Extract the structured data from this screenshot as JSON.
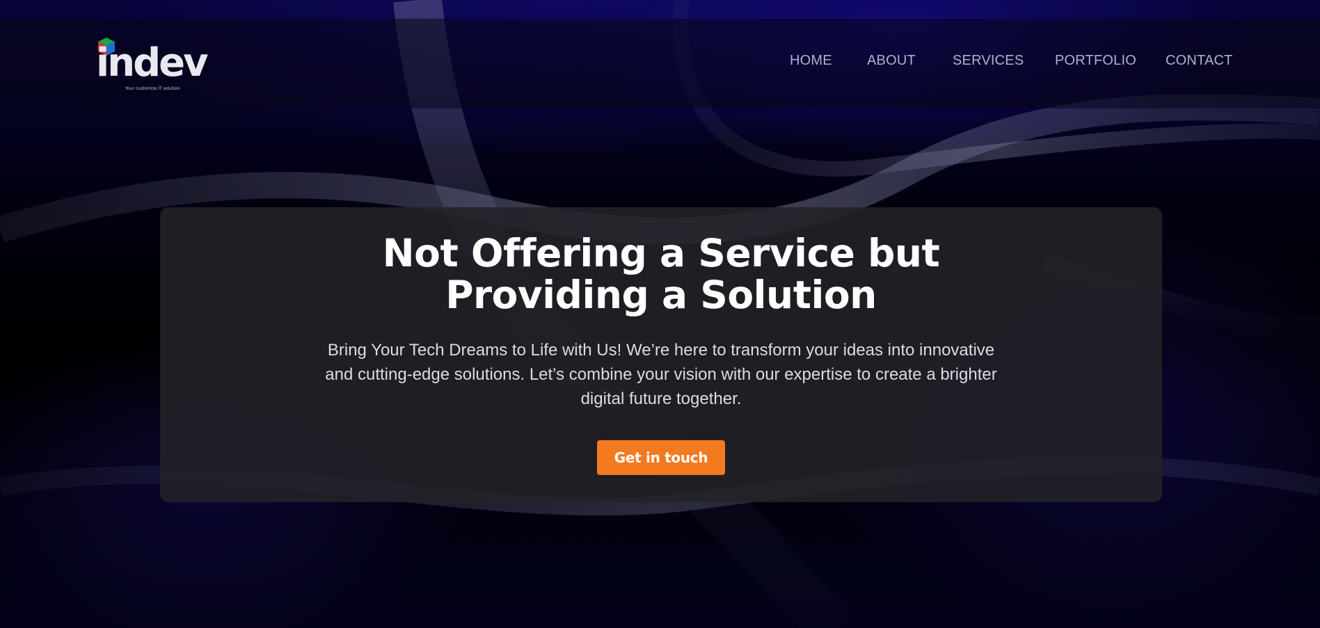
{
  "logo": {
    "wordmark": "indev",
    "tagline": "Your customize IT solution",
    "cube_colors": [
      "#1fa34a",
      "#d9312a",
      "#1f6fd6"
    ]
  },
  "nav": {
    "items": [
      "HOME",
      "ABOUT",
      "SERVICES",
      "PORTFOLIO",
      "CONTACT"
    ]
  },
  "hero": {
    "title_line1": "Not Offering a Service but",
    "title_line2": "Providing a Solution",
    "subtitle_line1": "Bring Your Tech Dreams to Life with Us! We’re here to transform your ideas into innovative",
    "subtitle_line2": "and cutting-edge solutions. Let’s combine your vision with our expertise to create a brighter",
    "subtitle_line3": "digital future together.",
    "cta_label": "Get in touch"
  },
  "colors": {
    "accent": "#f47a1f",
    "nav_text": "#aeb1cc",
    "background_deep": "#06043a"
  }
}
